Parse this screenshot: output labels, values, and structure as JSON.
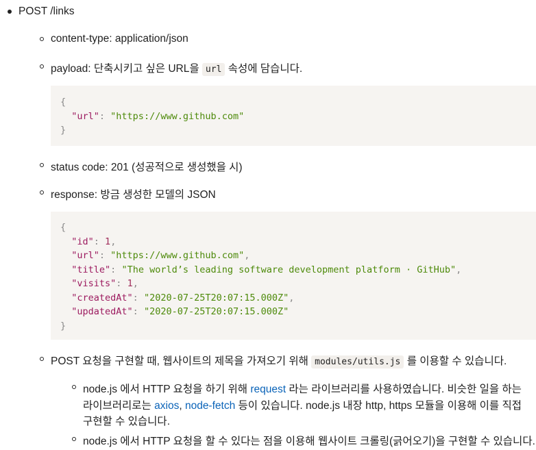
{
  "endpoint": "POST /links",
  "content_type": "content-type: application/json",
  "payload": {
    "prefix": "payload: 단축시키고 싶은 URL을",
    "code": "url",
    "suffix": "속성에 담습니다.",
    "json_open": "{",
    "key": "\"url\"",
    "value": "\"https://www.github.com\"",
    "json_close": "}"
  },
  "status": "status code: 201 (성공적으로 생성했을 시)",
  "response": {
    "label": "response: 방금 생성한 모델의 JSON",
    "open": "{",
    "close": "}",
    "lines": [
      {
        "key": "\"id\"",
        "value": "1",
        "type": "number"
      },
      {
        "key": "\"url\"",
        "value": "\"https://www.github.com\"",
        "type": "string"
      },
      {
        "key": "\"title\"",
        "value": "\"The world’s leading software development platform · GitHub\"",
        "type": "string"
      },
      {
        "key": "\"visits\"",
        "value": "1",
        "type": "number"
      },
      {
        "key": "\"createdAt\"",
        "value": "\"2020-07-25T20:07:15.000Z\"",
        "type": "string"
      },
      {
        "key": "\"updatedAt\"",
        "value": "\"2020-07-25T20:07:15.000Z\"",
        "type": "string"
      }
    ]
  },
  "post_note": {
    "prefix": "POST 요청을 구현할 때, 웹사이트의 제목을 가져오기 위해",
    "code": "modules/utils.js",
    "suffix": "를 이용할 수 있습니다."
  },
  "sub1": {
    "a": "node.js 에서 HTTP 요청을 하기 위해",
    "link_request": "request",
    "b": "라는 라이브러리를 사용하였습니다. 비슷한 일을 하는",
    "c": "라이브러리로는",
    "link_axios": "axios",
    "comma": ",",
    "link_nodefetch": "node-fetch",
    "d": "등이 있습니다. node.js 내장 http, https 모듈을 이용해 이를 직접",
    "e": "구현할 수 있습니다."
  },
  "sub2": "node.js 에서 HTTP 요청을 할 수 있다는 점을 이용해 웹사이트 크롤링(긁어오기)을 구현할 수 있습니다."
}
